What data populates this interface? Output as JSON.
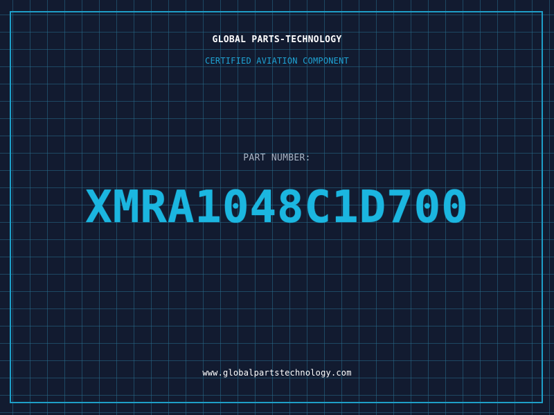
{
  "header": {
    "company": "GLOBAL PARTS-TECHNOLOGY",
    "subtitle": "CERTIFIED AVIATION COMPONENT"
  },
  "part": {
    "label": "PART NUMBER:",
    "number": "XMRA1048C1D700"
  },
  "footer": {
    "website": "www.globalpartstechnology.com"
  },
  "colors": {
    "background": "#121b30",
    "grid": "#286e8c",
    "accent": "#1bb6e0",
    "frame": "#1e9fc8"
  }
}
